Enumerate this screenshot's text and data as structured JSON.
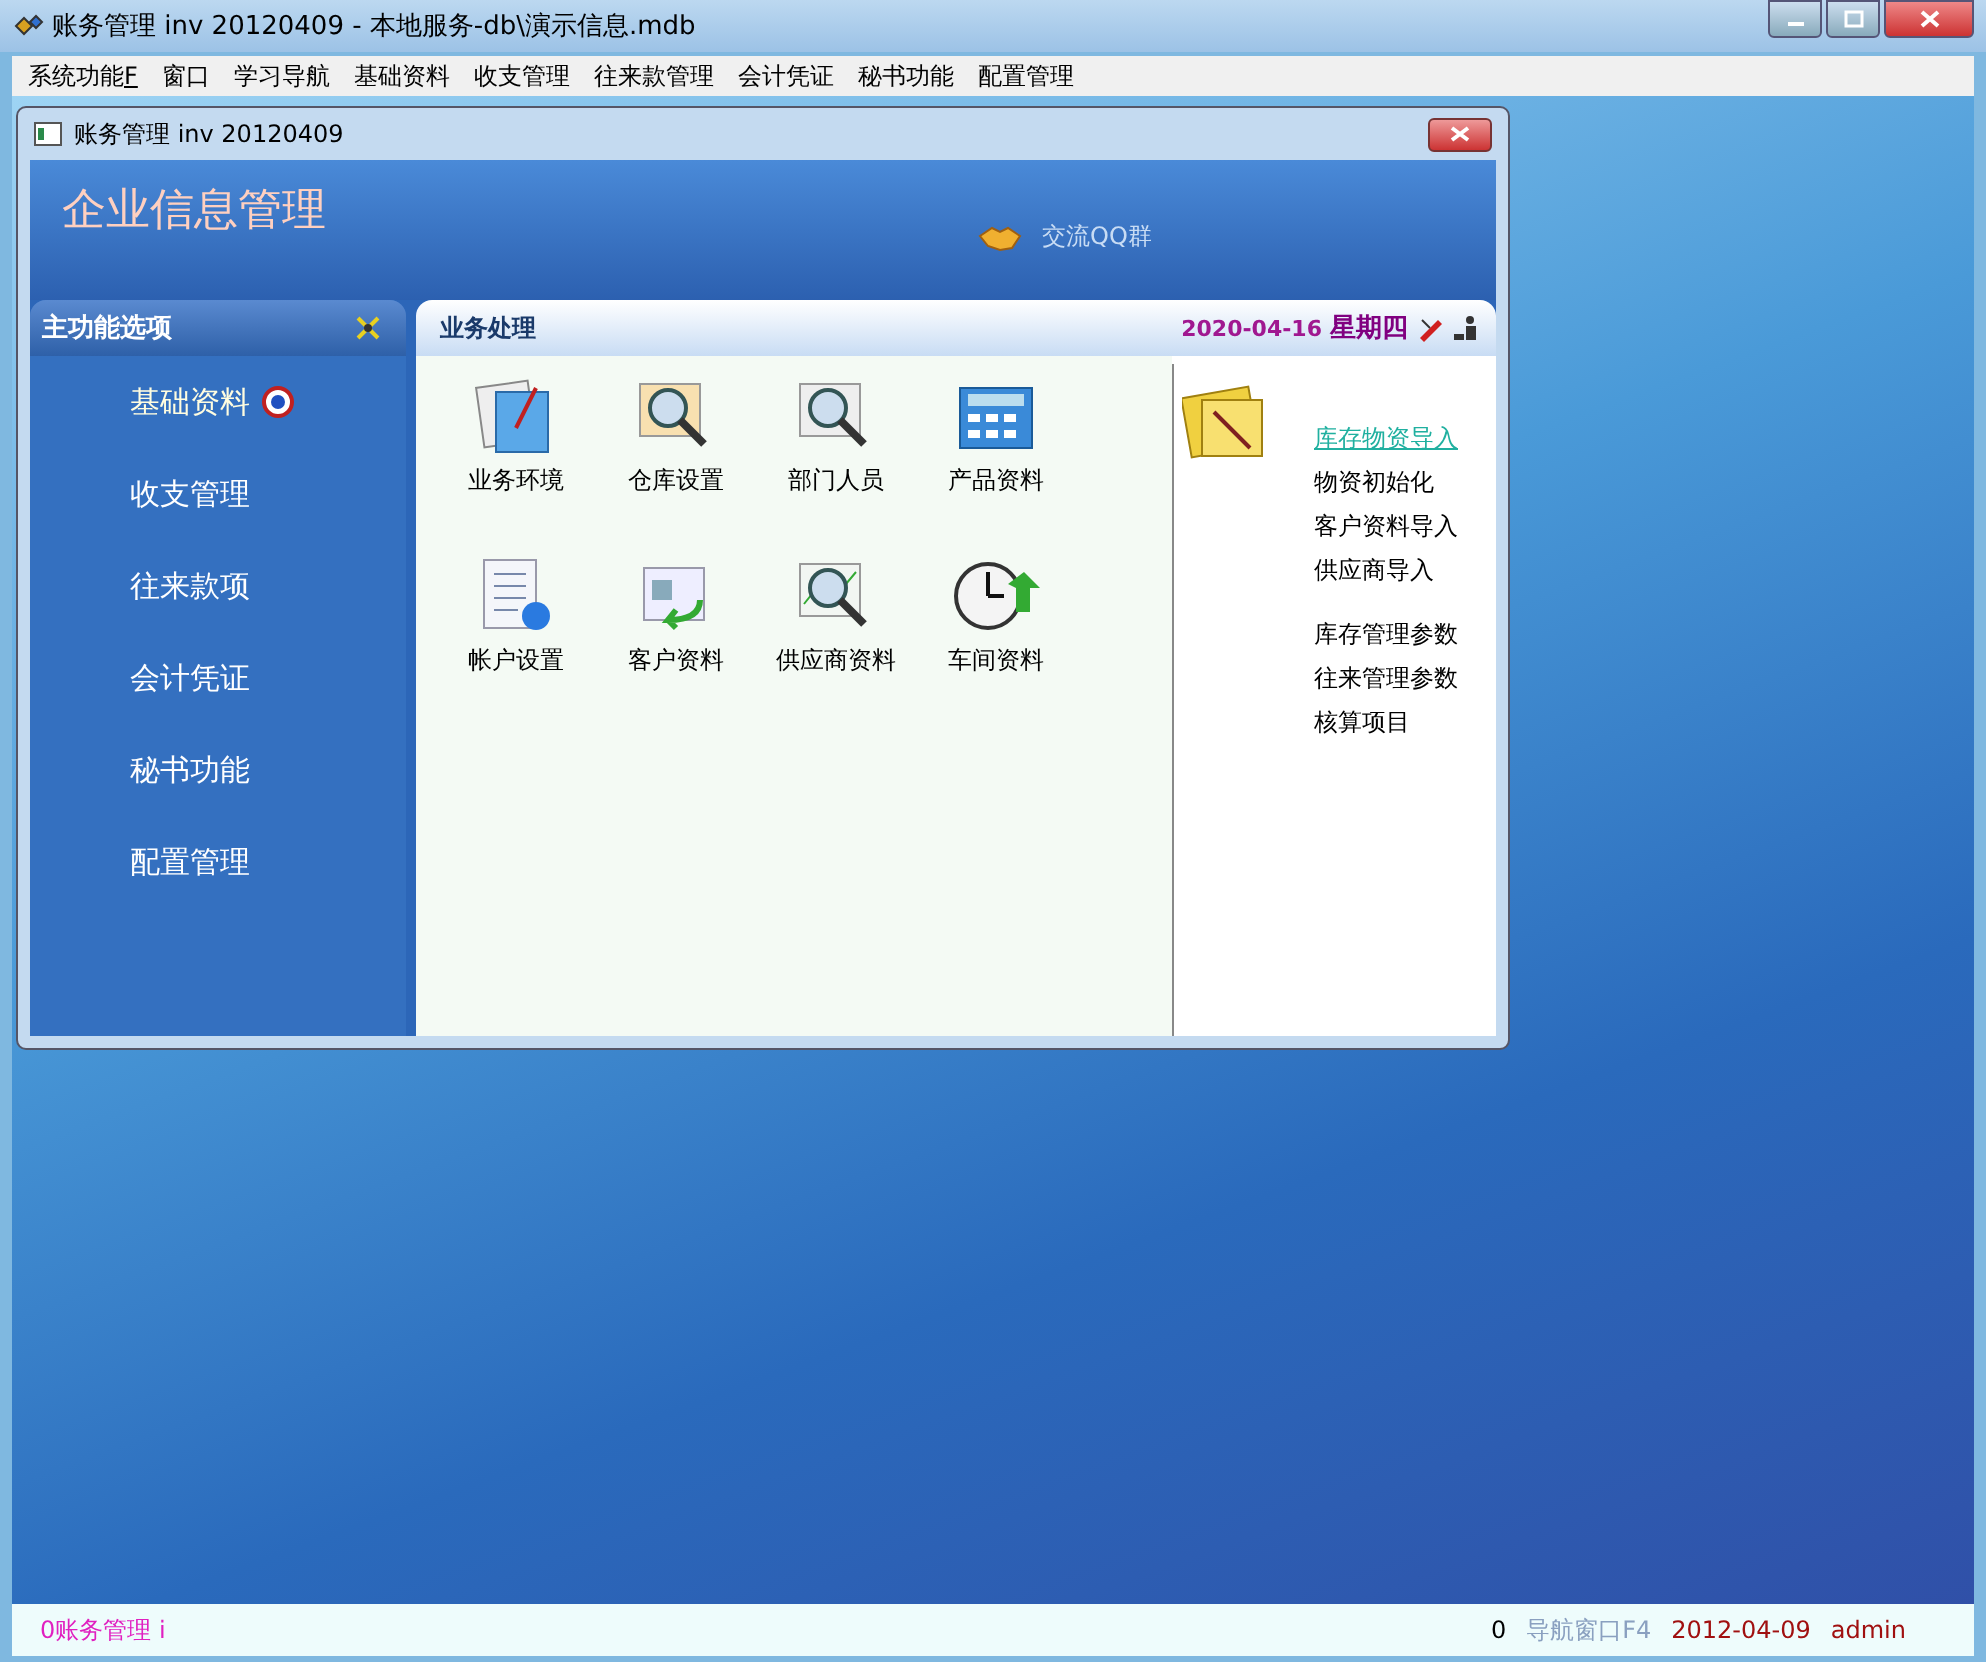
{
  "window": {
    "title": "账务管理 inv 20120409 - 本地服务-db\\演示信息.mdb"
  },
  "menu": [
    {
      "label": "系统功能",
      "key": "F"
    },
    {
      "label": "窗口"
    },
    {
      "label": "学习导航"
    },
    {
      "label": "基础资料"
    },
    {
      "label": "收支管理"
    },
    {
      "label": "往来款管理"
    },
    {
      "label": "会计凭证"
    },
    {
      "label": "秘书功能"
    },
    {
      "label": "配置管理"
    }
  ],
  "child_window": {
    "title": "账务管理 inv 20120409",
    "banner_title": "企业信息管理",
    "qq_link": "交流QQ群"
  },
  "sidebar": {
    "title": "主功能选项",
    "items": [
      {
        "label": "基础资料",
        "selected": true
      },
      {
        "label": "收支管理",
        "selected": false
      },
      {
        "label": "往来款项",
        "selected": false
      },
      {
        "label": "会计凭证",
        "selected": false
      },
      {
        "label": "秘书功能",
        "selected": false
      },
      {
        "label": "配置管理",
        "selected": false
      }
    ]
  },
  "panel": {
    "title": "业务处理",
    "date": "2020-04-16",
    "weekday": "星期四",
    "tiles": [
      {
        "label": "业务环境",
        "kind": "env"
      },
      {
        "label": "仓库设置",
        "kind": "warehouse"
      },
      {
        "label": "部门人员",
        "kind": "magnifier"
      },
      {
        "label": "产品资料",
        "kind": "calculator"
      },
      {
        "label": "帐户设置",
        "kind": "list"
      },
      {
        "label": "客户资料",
        "kind": "customer"
      },
      {
        "label": "供应商资料",
        "kind": "chart"
      },
      {
        "label": "车间资料",
        "kind": "clock"
      }
    ],
    "link_groups": [
      [
        {
          "label": "库存物资导入",
          "hovered": true
        },
        {
          "label": "物资初始化",
          "hovered": false
        },
        {
          "label": "客户资料导入",
          "hovered": false
        },
        {
          "label": "供应商导入",
          "hovered": false
        }
      ],
      [
        {
          "label": "库存管理参数",
          "hovered": false
        },
        {
          "label": "往来管理参数",
          "hovered": false
        },
        {
          "label": "核算项目",
          "hovered": false
        }
      ]
    ]
  },
  "status_bar": {
    "left": "0账务管理 i",
    "count": "0",
    "nav": "导航窗口F4",
    "date": "2012-04-09",
    "user": "admin"
  }
}
